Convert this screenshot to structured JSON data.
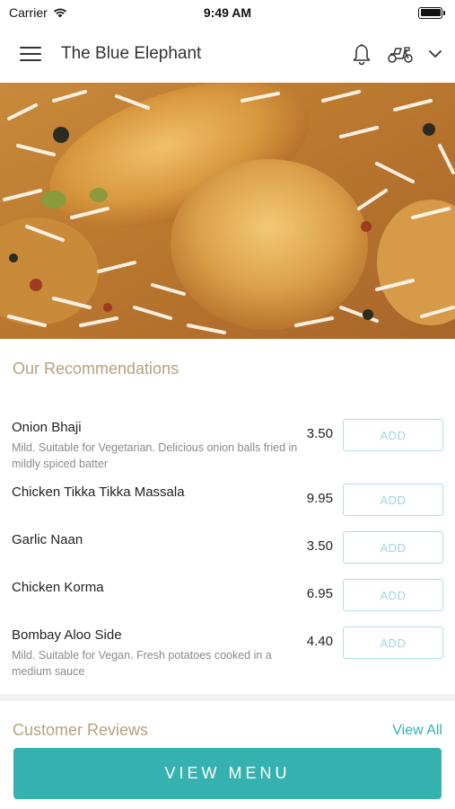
{
  "status_bar": {
    "carrier": "Carrier",
    "time": "9:49 AM",
    "battery_level": 1.0
  },
  "header": {
    "title": "The Blue Elephant",
    "icons": [
      "menu-icon",
      "bell-icon",
      "scooter-icon",
      "chevron-down-icon"
    ]
  },
  "hero": {
    "description_icon": "food-photo"
  },
  "recommendations": {
    "title": "Our Recommendations",
    "add_label": "ADD",
    "items": [
      {
        "name": "Onion Bhaji",
        "price": "3.50",
        "description": "Mild. Suitable for Vegetarian. Delicious onion balls fried in mildly spiced batter"
      },
      {
        "name": "Chicken Tikka Tikka Massala",
        "price": "9.95",
        "description": ""
      },
      {
        "name": "Garlic Naan",
        "price": "3.50",
        "description": ""
      },
      {
        "name": "Chicken Korma",
        "price": "6.95",
        "description": ""
      },
      {
        "name": "Bombay Aloo Side",
        "price": "4.40",
        "description": "Mild. Suitable for Vegan. Fresh potatoes cooked in a medium sauce"
      }
    ]
  },
  "reviews": {
    "title": "Customer Reviews",
    "view_all": "View All"
  },
  "footer": {
    "view_menu": "VIEW MENU"
  },
  "colors": {
    "accent": "#35b1b0",
    "section_title": "#b4a27c",
    "add_border": "#aee0e3"
  }
}
